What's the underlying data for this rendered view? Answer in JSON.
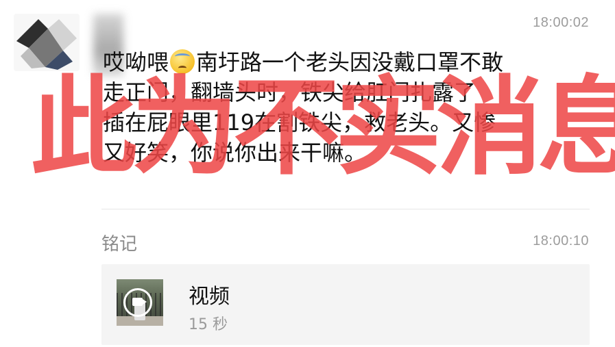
{
  "message1": {
    "time": "18:00:02",
    "lines": [
      {
        "before": "哎呦喂",
        "after": "南圩路一个老头因没戴口罩不敢"
      },
      "走正门，翻墙头时，铁尖给肛门扎露了",
      "插在屁眼里119在割铁尖，救老头。又惨",
      "又好笑，你说你出来干嘛。"
    ],
    "emoji": "sweat-face-emoji"
  },
  "message2": {
    "sender": "铭记",
    "time": "18:00:10",
    "video": {
      "title": "视频",
      "duration": "15 秒"
    }
  },
  "watermark": "此为不实消息"
}
